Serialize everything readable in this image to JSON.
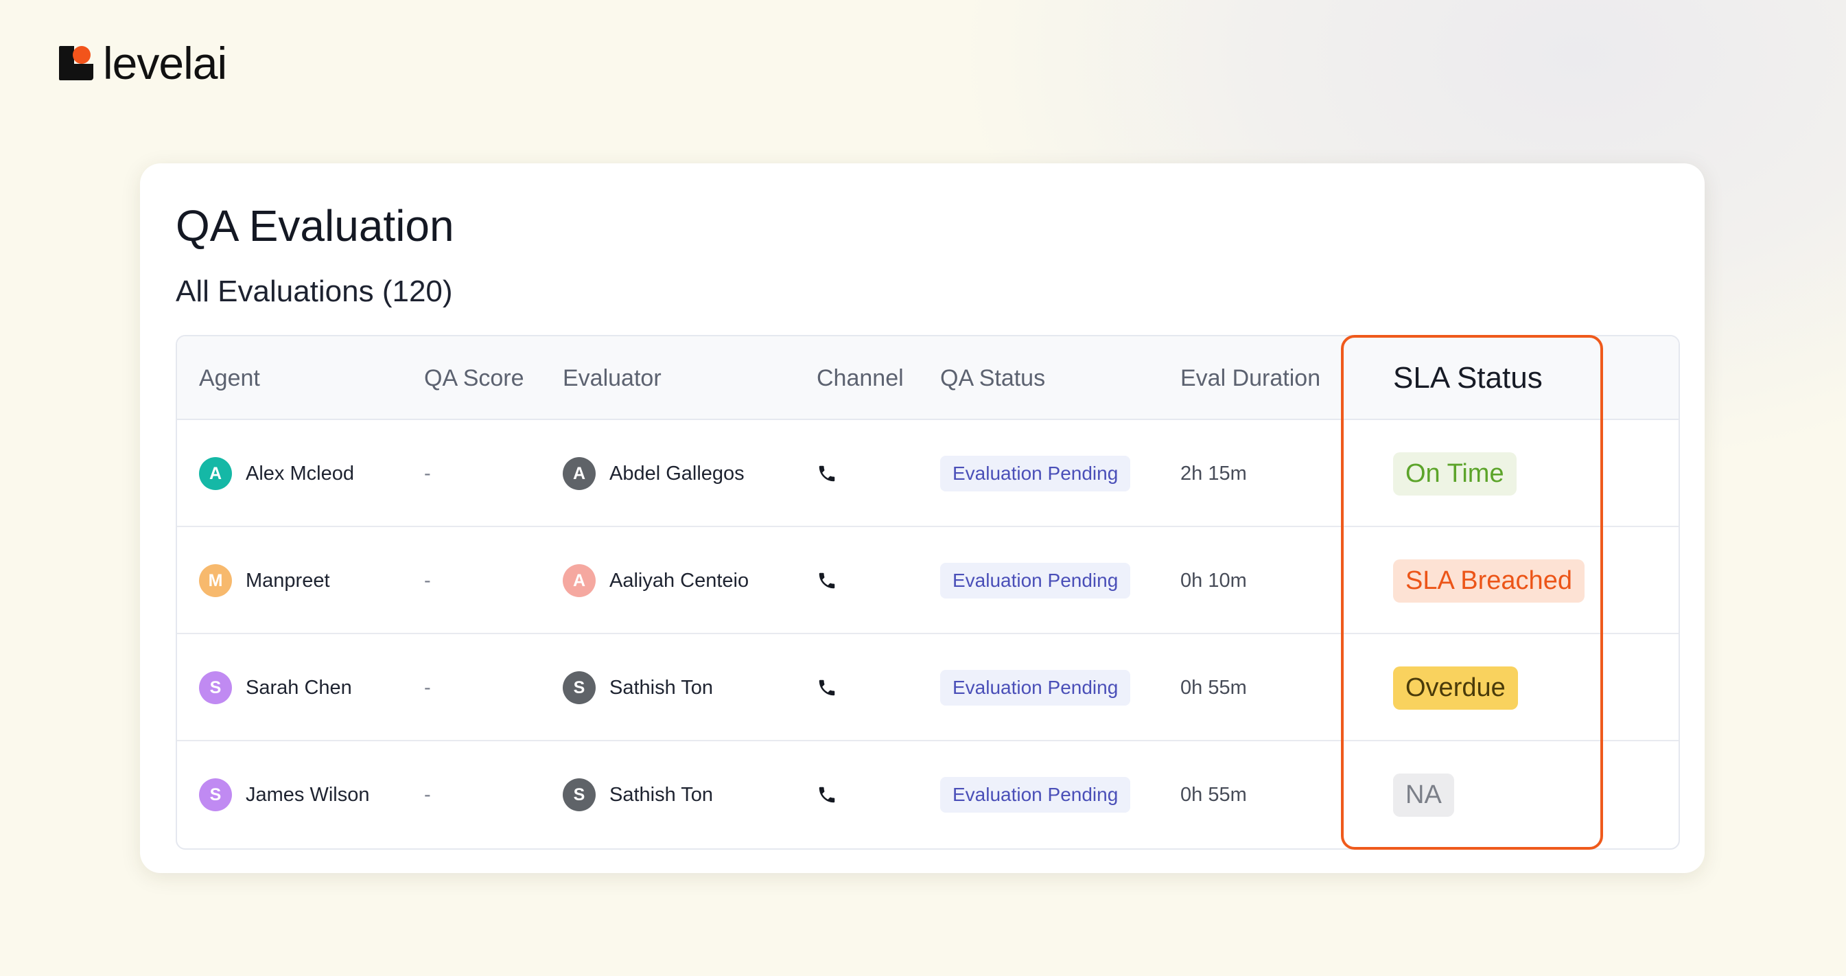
{
  "brand": {
    "name": "levelai",
    "accent": "#f2541b"
  },
  "page": {
    "title": "QA Evaluation",
    "subtitle": "All Evaluations (120)"
  },
  "table": {
    "headers": {
      "agent": "Agent",
      "qa_score": "QA Score",
      "evaluator": "Evaluator",
      "channel": "Channel",
      "qa_status": "QA Status",
      "eval_duration": "Eval Duration",
      "sla_status": "SLA Status"
    },
    "rows": [
      {
        "agent": {
          "initial": "A",
          "name": "Alex Mcleod",
          "color": "#15b8a6"
        },
        "qa_score": "-",
        "evaluator": {
          "initial": "A",
          "name": "Abdel Gallegos",
          "color": "#5f6368"
        },
        "channel_icon": "phone-icon",
        "qa_status": "Evaluation Pending",
        "eval_duration": "2h 15m",
        "sla": {
          "label": "On Time",
          "bg": "#eef4e4",
          "fg": "#5ca42a"
        }
      },
      {
        "agent": {
          "initial": "M",
          "name": "Manpreet",
          "color": "#f7b96d"
        },
        "qa_score": "-",
        "evaluator": {
          "initial": "A",
          "name": "Aaliyah Centeio",
          "color": "#f5a8a0"
        },
        "channel_icon": "phone-icon",
        "qa_status": "Evaluation Pending",
        "eval_duration": "0h 10m",
        "sla": {
          "label": "SLA Breached",
          "bg": "#fde2d4",
          "fg": "#ec5518"
        }
      },
      {
        "agent": {
          "initial": "S",
          "name": "Sarah Chen",
          "color": "#c08af2"
        },
        "qa_score": "-",
        "evaluator": {
          "initial": "S",
          "name": "Sathish Ton",
          "color": "#5f6368"
        },
        "channel_icon": "phone-icon",
        "qa_status": "Evaluation Pending",
        "eval_duration": "0h 55m",
        "sla": {
          "label": "Overdue",
          "bg": "#f9d25e",
          "fg": "#4a3b0a"
        }
      },
      {
        "agent": {
          "initial": "S",
          "name": "James Wilson",
          "color": "#c08af2"
        },
        "qa_score": "-",
        "evaluator": {
          "initial": "S",
          "name": "Sathish Ton",
          "color": "#5f6368"
        },
        "channel_icon": "phone-icon",
        "qa_status": "Evaluation Pending",
        "eval_duration": "0h 55m",
        "sla": {
          "label": "NA",
          "bg": "#ececee",
          "fg": "#7b7f88"
        }
      }
    ]
  },
  "highlight_color": "#ef5a1c"
}
